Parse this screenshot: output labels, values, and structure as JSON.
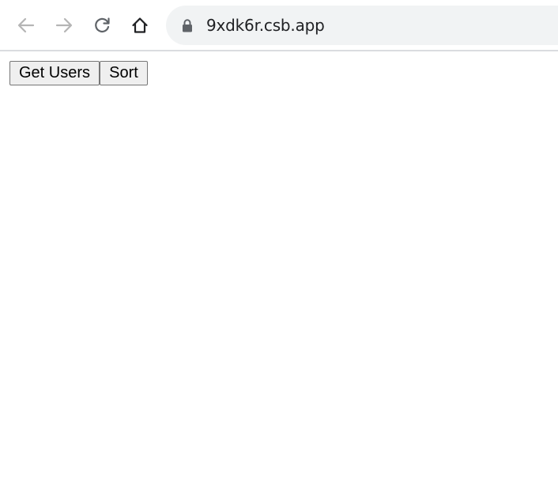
{
  "browser": {
    "back_icon": "arrow-left-icon",
    "forward_icon": "arrow-right-icon",
    "reload_icon": "reload-icon",
    "home_icon": "home-icon",
    "lock_icon": "lock-icon",
    "url": "9xdk6r.csb.app",
    "colors": {
      "nav_disabled": "#b5b5b5",
      "nav_active": "#5f6368",
      "omnibox_bg": "#f1f3f4"
    }
  },
  "page": {
    "buttons": {
      "get_users_label": "Get Users",
      "sort_label": "Sort"
    }
  }
}
